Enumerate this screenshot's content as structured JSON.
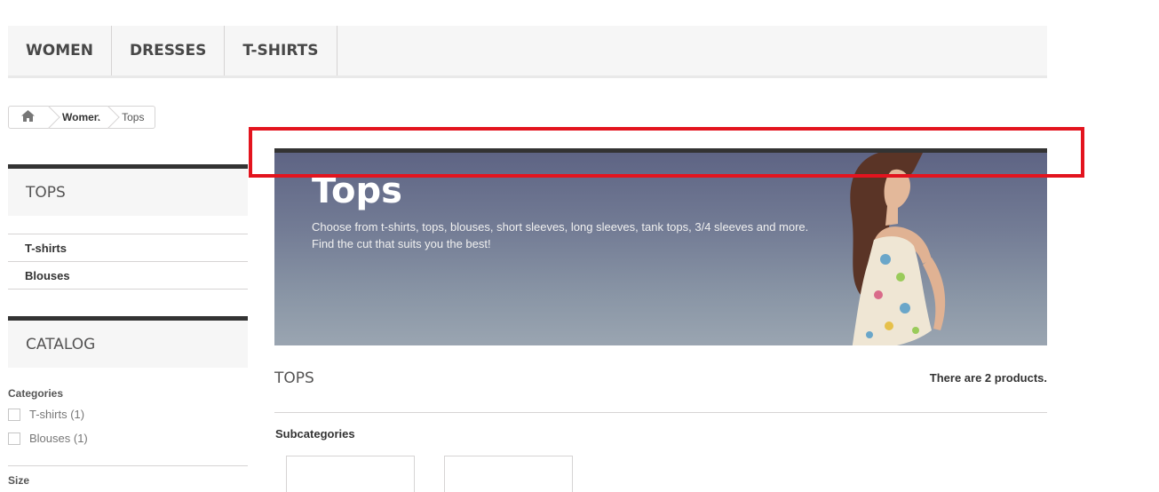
{
  "menu": {
    "items": [
      {
        "label": "Women"
      },
      {
        "label": "Dresses"
      },
      {
        "label": "T-shirts"
      }
    ]
  },
  "breadcrumb": {
    "home_icon": "home-icon",
    "items": [
      {
        "label": "Women"
      },
      {
        "label": "Tops"
      }
    ]
  },
  "sidebar": {
    "category_block": {
      "title": "Tops",
      "items": [
        {
          "label": "T-shirts"
        },
        {
          "label": "Blouses"
        }
      ]
    },
    "catalog_block": {
      "title": "Catalog",
      "filters": {
        "categories_label": "Categories",
        "categories": [
          {
            "label": "T-shirts (1)",
            "checked": false
          },
          {
            "label": "Blouses (1)",
            "checked": false
          }
        ],
        "size_label": "Size"
      }
    }
  },
  "banner": {
    "title": "Tops",
    "description_line1": "Choose from t-shirts, tops, blouses, short sleeves, long sleeves, tank tops, 3/4 sleeves and more.",
    "description_line2": "Find the cut that suits you the best!"
  },
  "main": {
    "heading": "Tops",
    "product_count": "There are 2 products.",
    "subcategories_heading": "Subcategories"
  },
  "colors": {
    "highlight": "#e3141e",
    "accent_dark": "#333333"
  }
}
